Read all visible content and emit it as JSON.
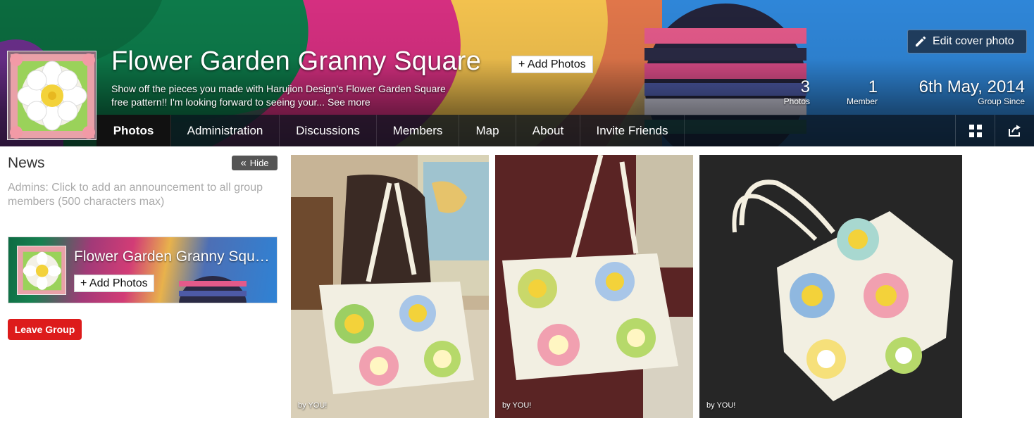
{
  "group": {
    "title": "Flower Garden Granny Square",
    "description": "Show off the pieces you made with Harujion Design's Flower Garden Square free pattern!! I'm looking forward to seeing your...",
    "see_more": "See more",
    "add_photos": "+ Add Photos"
  },
  "cover": {
    "edit_label": "Edit cover photo"
  },
  "stats": {
    "photos_count": "3",
    "photos_label": "Photos",
    "members_count": "1",
    "members_label": "Member",
    "since_value": "6th May, 2014",
    "since_label": "Group Since"
  },
  "nav": {
    "tabs": [
      {
        "label": "Photos",
        "active": true
      },
      {
        "label": "Administration"
      },
      {
        "label": "Discussions"
      },
      {
        "label": "Members"
      },
      {
        "label": "Map"
      },
      {
        "label": "About"
      },
      {
        "label": "Invite Friends"
      }
    ],
    "icons": [
      "grid-view-icon",
      "share-icon"
    ]
  },
  "news": {
    "title": "News",
    "hide_label": "Hide",
    "hint": "Admins: Click to add an announcement to all group members (500 characters max)"
  },
  "mini_card": {
    "title": "Flower Garden Granny Square",
    "add_photos": "+ Add Photos"
  },
  "leave_group": "Leave Group",
  "photos": [
    {
      "caption": "by YOU!"
    },
    {
      "caption": "by YOU!"
    },
    {
      "caption": "by YOU!"
    }
  ],
  "colors": {
    "nav_bg": "#0a141e",
    "edit_button_bg": "#1f3c5c",
    "leave_button_bg": "#dd1b1b",
    "hide_button_bg": "#555555"
  }
}
